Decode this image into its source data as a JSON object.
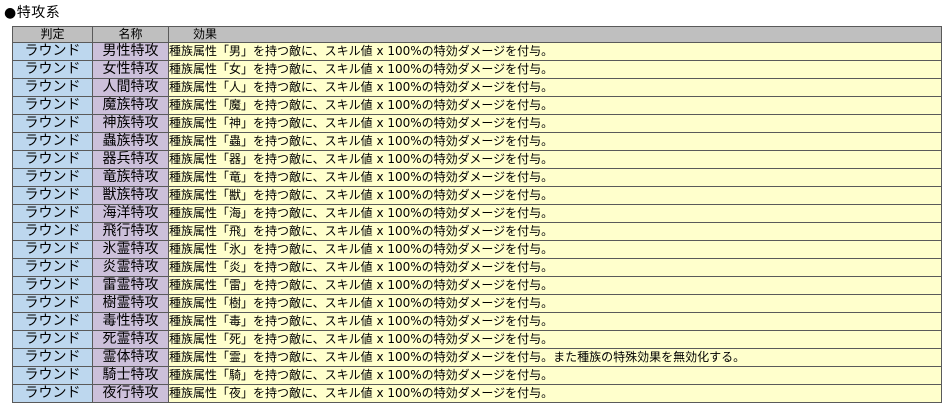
{
  "section_title": "●特攻系",
  "headers": {
    "judge": "判定",
    "name": "名称",
    "effect": "効果"
  },
  "colors": {
    "header_bg": "#bfbfbf",
    "judge_bg": "#bdd7ee",
    "name_bg": "#ccc0da",
    "effect_bg": "#ffffcc"
  },
  "rows": [
    {
      "judge": "ラウンド",
      "name": "男性特攻",
      "effect": "種族属性「男」を持つ敵に、スキル値 x 100%の特効ダメージを付与。"
    },
    {
      "judge": "ラウンド",
      "name": "女性特攻",
      "effect": "種族属性「女」を持つ敵に、スキル値 x 100%の特効ダメージを付与。"
    },
    {
      "judge": "ラウンド",
      "name": "人間特攻",
      "effect": "種族属性「人」を持つ敵に、スキル値 x 100%の特効ダメージを付与。"
    },
    {
      "judge": "ラウンド",
      "name": "魔族特攻",
      "effect": "種族属性「魔」を持つ敵に、スキル値 x 100%の特効ダメージを付与。"
    },
    {
      "judge": "ラウンド",
      "name": "神族特攻",
      "effect": "種族属性「神」を持つ敵に、スキル値 x 100%の特効ダメージを付与。"
    },
    {
      "judge": "ラウンド",
      "name": "蟲族特攻",
      "effect": "種族属性「蟲」を持つ敵に、スキル値 x 100%の特効ダメージを付与。"
    },
    {
      "judge": "ラウンド",
      "name": "器兵特攻",
      "effect": "種族属性「器」を持つ敵に、スキル値 x 100%の特効ダメージを付与。"
    },
    {
      "judge": "ラウンド",
      "name": "竜族特攻",
      "effect": "種族属性「竜」を持つ敵に、スキル値 x 100%の特効ダメージを付与。"
    },
    {
      "judge": "ラウンド",
      "name": "獣族特攻",
      "effect": "種族属性「獣」を持つ敵に、スキル値 x 100%の特効ダメージを付与。"
    },
    {
      "judge": "ラウンド",
      "name": "海洋特攻",
      "effect": "種族属性「海」を持つ敵に、スキル値 x 100%の特効ダメージを付与。"
    },
    {
      "judge": "ラウンド",
      "name": "飛行特攻",
      "effect": "種族属性「飛」を持つ敵に、スキル値 x 100%の特効ダメージを付与。"
    },
    {
      "judge": "ラウンド",
      "name": "氷霊特攻",
      "effect": "種族属性「氷」を持つ敵に、スキル値 x 100%の特効ダメージを付与。"
    },
    {
      "judge": "ラウンド",
      "name": "炎霊特攻",
      "effect": "種族属性「炎」を持つ敵に、スキル値 x 100%の特効ダメージを付与。"
    },
    {
      "judge": "ラウンド",
      "name": "雷霊特攻",
      "effect": "種族属性「雷」を持つ敵に、スキル値 x 100%の特効ダメージを付与。"
    },
    {
      "judge": "ラウンド",
      "name": "樹霊特攻",
      "effect": "種族属性「樹」を持つ敵に、スキル値 x 100%の特効ダメージを付与。"
    },
    {
      "judge": "ラウンド",
      "name": "毒性特攻",
      "effect": "種族属性「毒」を持つ敵に、スキル値 x 100%の特効ダメージを付与。"
    },
    {
      "judge": "ラウンド",
      "name": "死霊特攻",
      "effect": "種族属性「死」を持つ敵に、スキル値 x 100%の特効ダメージを付与。"
    },
    {
      "judge": "ラウンド",
      "name": "霊体特攻",
      "effect": "種族属性「霊」を持つ敵に、スキル値 x 100%の特効ダメージを付与。また種族の特殊効果を無効化する。"
    },
    {
      "judge": "ラウンド",
      "name": "騎士特攻",
      "effect": "種族属性「騎」を持つ敵に、スキル値 x 100%の特効ダメージを付与。"
    },
    {
      "judge": "ラウンド",
      "name": "夜行特攻",
      "effect": "種族属性「夜」を持つ敵に、スキル値 x 100%の特効ダメージを付与。"
    }
  ]
}
